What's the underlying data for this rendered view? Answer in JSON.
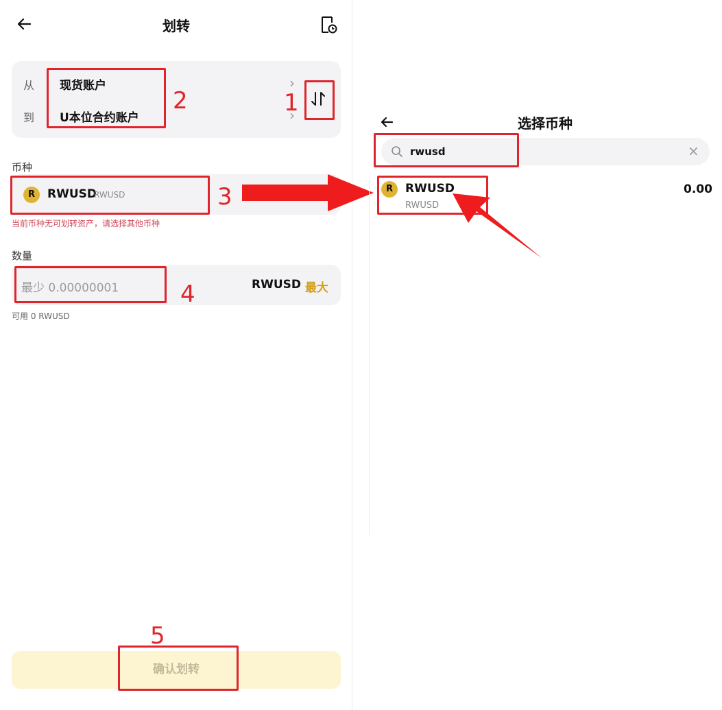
{
  "left_panel": {
    "title": "划转",
    "from_label": "从",
    "from_account": "现货账户",
    "to_label": "到",
    "to_account": "U本位合约账户",
    "coin_section_label": "币种",
    "coin_symbol": "RWUSD",
    "coin_subname": "RWUSD",
    "coin_logo_letter": "R",
    "error_text": "当前币种无可划转资产，请选择其他币种",
    "amount_section_label": "数量",
    "amount_placeholder": "最少 0.00000001",
    "amount_unit": "RWUSD",
    "max_label": "最大",
    "available_text": "可用 0 RWUSD",
    "confirm_label": "确认划转"
  },
  "right_panel": {
    "title": "选择币种",
    "search_value": "rwusd",
    "result": {
      "logo_letter": "R",
      "name": "RWUSD",
      "subname": "RWUSD",
      "balance": "0.00"
    }
  },
  "annotations": {
    "labels": [
      "1",
      "2",
      "3",
      "4",
      "5"
    ],
    "color": "#e0242b"
  },
  "colors": {
    "accent_gold": "#d4a017",
    "coin_logo": "#e0b433",
    "error": "#d0475a",
    "confirm_bg": "#fdf5d2"
  }
}
